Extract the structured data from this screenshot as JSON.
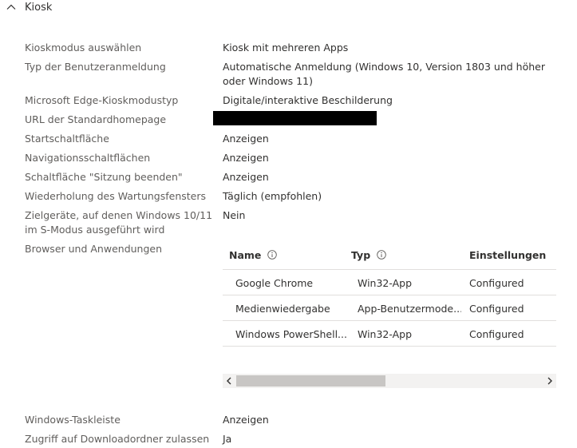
{
  "section": {
    "title": "Kiosk"
  },
  "rows": [
    {
      "label": "Kioskmodus auswählen",
      "value": "Kiosk mit mehreren Apps"
    },
    {
      "label": "Typ der Benutzeranmeldung",
      "value": "Automatische Anmeldung (Windows 10, Version 1803 und höher oder Windows 11)"
    },
    {
      "label": "Microsoft Edge-Kioskmodustyp",
      "value": "Digitale/interaktive Beschilderung"
    },
    {
      "label": "URL der Standardhomepage",
      "value": ""
    },
    {
      "label": "Startschaltfläche",
      "value": "Anzeigen"
    },
    {
      "label": "Navigationsschaltflächen",
      "value": "Anzeigen"
    },
    {
      "label": "Schaltfläche \"Sitzung beenden\"",
      "value": "Anzeigen"
    },
    {
      "label": "Wiederholung des Wartungsfensters",
      "value": "Täglich (empfohlen)"
    },
    {
      "label": "Zielgeräte, auf denen Windows 10/11 im S-Modus ausgeführt wird",
      "value": "Nein"
    },
    {
      "label": "Browser und Anwendungen",
      "value": ""
    }
  ],
  "table": {
    "columns": [
      "Name",
      "Typ",
      "Einstellungen"
    ],
    "rows": [
      [
        "Google Chrome",
        "Win32-App",
        "Configured"
      ],
      [
        "Medienwiedergabe",
        "App-Benutzermode...",
        "Configured"
      ],
      [
        "Windows PowerShell...",
        "Win32-App",
        "Configured"
      ]
    ]
  },
  "bottom_rows": [
    {
      "label": "Windows-Taskleiste",
      "value": "Anzeigen"
    },
    {
      "label": "Zugriff auf Downloadordner zulassen",
      "value": "Ja"
    }
  ],
  "icons": {
    "chevron": "chevron-up-icon",
    "info": "info-icon",
    "scroll_left": "chevron-left-icon",
    "scroll_right": "chevron-right-icon"
  },
  "colors": {
    "label": "#605e5c",
    "text": "#323130",
    "divider": "#e1dfdd",
    "scrollbar_thumb": "#c8c6c4"
  }
}
